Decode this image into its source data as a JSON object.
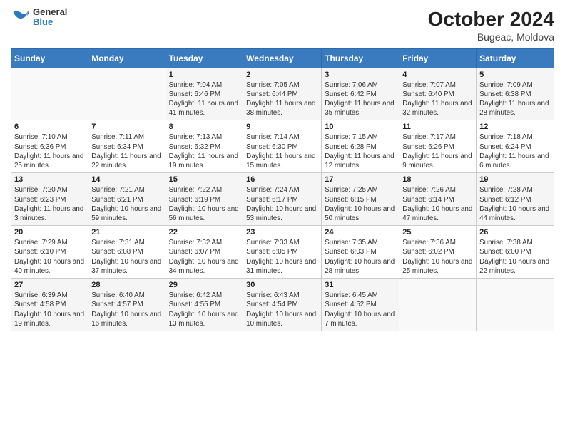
{
  "header": {
    "logo_general": "General",
    "logo_blue": "Blue",
    "title": "October 2024",
    "subtitle": "Bugeac, Moldova"
  },
  "days_of_week": [
    "Sunday",
    "Monday",
    "Tuesday",
    "Wednesday",
    "Thursday",
    "Friday",
    "Saturday"
  ],
  "weeks": [
    [
      {
        "day": "",
        "info": ""
      },
      {
        "day": "",
        "info": ""
      },
      {
        "day": "1",
        "info": "Sunrise: 7:04 AM\nSunset: 6:46 PM\nDaylight: 11 hours and 41 minutes."
      },
      {
        "day": "2",
        "info": "Sunrise: 7:05 AM\nSunset: 6:44 PM\nDaylight: 11 hours and 38 minutes."
      },
      {
        "day": "3",
        "info": "Sunrise: 7:06 AM\nSunset: 6:42 PM\nDaylight: 11 hours and 35 minutes."
      },
      {
        "day": "4",
        "info": "Sunrise: 7:07 AM\nSunset: 6:40 PM\nDaylight: 11 hours and 32 minutes."
      },
      {
        "day": "5",
        "info": "Sunrise: 7:09 AM\nSunset: 6:38 PM\nDaylight: 11 hours and 28 minutes."
      }
    ],
    [
      {
        "day": "6",
        "info": "Sunrise: 7:10 AM\nSunset: 6:36 PM\nDaylight: 11 hours and 25 minutes."
      },
      {
        "day": "7",
        "info": "Sunrise: 7:11 AM\nSunset: 6:34 PM\nDaylight: 11 hours and 22 minutes."
      },
      {
        "day": "8",
        "info": "Sunrise: 7:13 AM\nSunset: 6:32 PM\nDaylight: 11 hours and 19 minutes."
      },
      {
        "day": "9",
        "info": "Sunrise: 7:14 AM\nSunset: 6:30 PM\nDaylight: 11 hours and 15 minutes."
      },
      {
        "day": "10",
        "info": "Sunrise: 7:15 AM\nSunset: 6:28 PM\nDaylight: 11 hours and 12 minutes."
      },
      {
        "day": "11",
        "info": "Sunrise: 7:17 AM\nSunset: 6:26 PM\nDaylight: 11 hours and 9 minutes."
      },
      {
        "day": "12",
        "info": "Sunrise: 7:18 AM\nSunset: 6:24 PM\nDaylight: 11 hours and 6 minutes."
      }
    ],
    [
      {
        "day": "13",
        "info": "Sunrise: 7:20 AM\nSunset: 6:23 PM\nDaylight: 11 hours and 3 minutes."
      },
      {
        "day": "14",
        "info": "Sunrise: 7:21 AM\nSunset: 6:21 PM\nDaylight: 10 hours and 59 minutes."
      },
      {
        "day": "15",
        "info": "Sunrise: 7:22 AM\nSunset: 6:19 PM\nDaylight: 10 hours and 56 minutes."
      },
      {
        "day": "16",
        "info": "Sunrise: 7:24 AM\nSunset: 6:17 PM\nDaylight: 10 hours and 53 minutes."
      },
      {
        "day": "17",
        "info": "Sunrise: 7:25 AM\nSunset: 6:15 PM\nDaylight: 10 hours and 50 minutes."
      },
      {
        "day": "18",
        "info": "Sunrise: 7:26 AM\nSunset: 6:14 PM\nDaylight: 10 hours and 47 minutes."
      },
      {
        "day": "19",
        "info": "Sunrise: 7:28 AM\nSunset: 6:12 PM\nDaylight: 10 hours and 44 minutes."
      }
    ],
    [
      {
        "day": "20",
        "info": "Sunrise: 7:29 AM\nSunset: 6:10 PM\nDaylight: 10 hours and 40 minutes."
      },
      {
        "day": "21",
        "info": "Sunrise: 7:31 AM\nSunset: 6:08 PM\nDaylight: 10 hours and 37 minutes."
      },
      {
        "day": "22",
        "info": "Sunrise: 7:32 AM\nSunset: 6:07 PM\nDaylight: 10 hours and 34 minutes."
      },
      {
        "day": "23",
        "info": "Sunrise: 7:33 AM\nSunset: 6:05 PM\nDaylight: 10 hours and 31 minutes."
      },
      {
        "day": "24",
        "info": "Sunrise: 7:35 AM\nSunset: 6:03 PM\nDaylight: 10 hours and 28 minutes."
      },
      {
        "day": "25",
        "info": "Sunrise: 7:36 AM\nSunset: 6:02 PM\nDaylight: 10 hours and 25 minutes."
      },
      {
        "day": "26",
        "info": "Sunrise: 7:38 AM\nSunset: 6:00 PM\nDaylight: 10 hours and 22 minutes."
      }
    ],
    [
      {
        "day": "27",
        "info": "Sunrise: 6:39 AM\nSunset: 4:58 PM\nDaylight: 10 hours and 19 minutes."
      },
      {
        "day": "28",
        "info": "Sunrise: 6:40 AM\nSunset: 4:57 PM\nDaylight: 10 hours and 16 minutes."
      },
      {
        "day": "29",
        "info": "Sunrise: 6:42 AM\nSunset: 4:55 PM\nDaylight: 10 hours and 13 minutes."
      },
      {
        "day": "30",
        "info": "Sunrise: 6:43 AM\nSunset: 4:54 PM\nDaylight: 10 hours and 10 minutes."
      },
      {
        "day": "31",
        "info": "Sunrise: 6:45 AM\nSunset: 4:52 PM\nDaylight: 10 hours and 7 minutes."
      },
      {
        "day": "",
        "info": ""
      },
      {
        "day": "",
        "info": ""
      }
    ]
  ]
}
